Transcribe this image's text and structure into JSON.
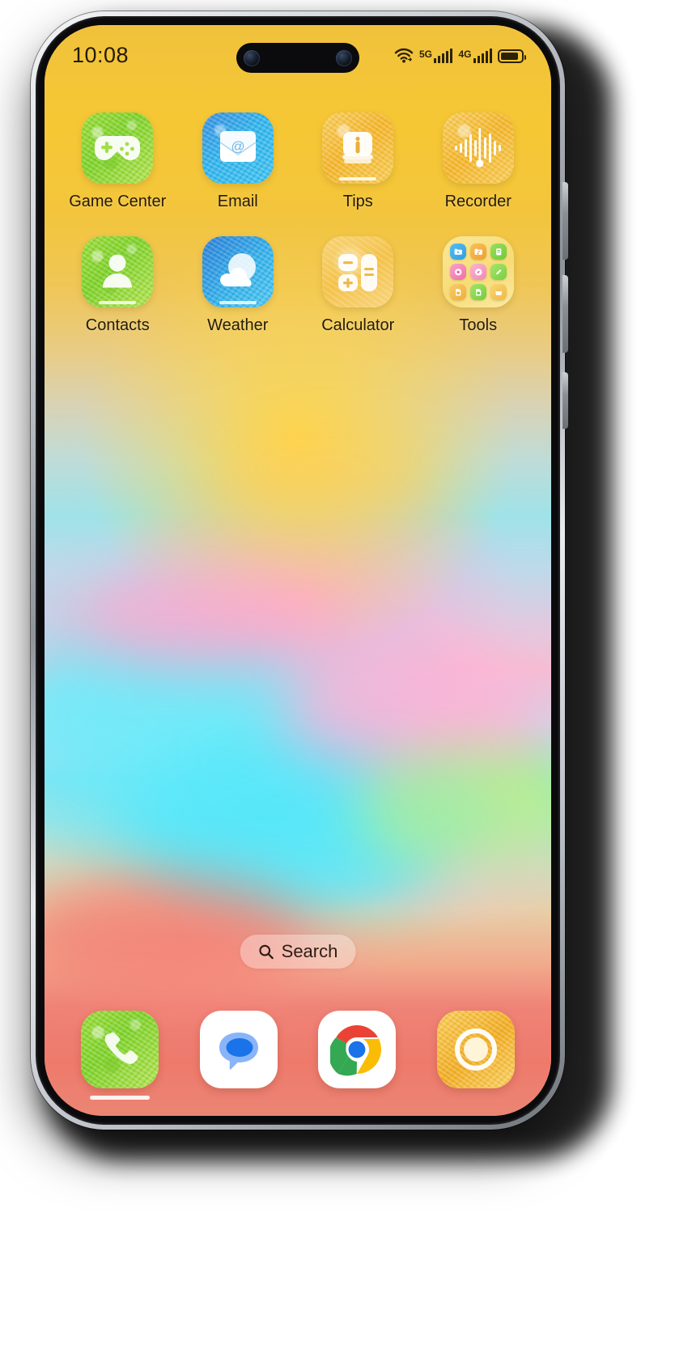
{
  "status_bar": {
    "time": "10:08",
    "icons": [
      {
        "name": "wifi-icon",
        "label": ""
      },
      {
        "name": "signal-5g-icon",
        "label": "5G"
      },
      {
        "name": "signal-4g-icon",
        "label": "4G"
      },
      {
        "name": "battery-icon",
        "label": ""
      }
    ]
  },
  "home_screen": {
    "rows": [
      [
        {
          "label": "Game Center",
          "icon": "gamepad-icon",
          "style": "tex-green",
          "dot": false
        },
        {
          "label": "Email",
          "icon": "envelope-at-icon",
          "style": "tex-blue",
          "dot": false
        },
        {
          "label": "Tips",
          "icon": "info-card-icon",
          "style": "tex-amber",
          "dot": true
        },
        {
          "label": "Recorder",
          "icon": "waveform-icon",
          "style": "tex-amber",
          "dot": false
        }
      ],
      [
        {
          "label": "Contacts",
          "icon": "person-icon",
          "style": "tex-green",
          "dot": true
        },
        {
          "label": "Weather",
          "icon": "sun-cloud-icon",
          "style": "tex-blue2",
          "dot": true
        },
        {
          "label": "Calculator",
          "icon": "calculator-icon",
          "style": "tex-amber-soft",
          "dot": false
        },
        {
          "label": "Tools",
          "icon": "folder-icon",
          "style": "tex-folder",
          "dot": false
        }
      ]
    ],
    "folder_apps": [
      {
        "name": "video-folder-icon",
        "color": "#3aa8e8"
      },
      {
        "name": "music-folder-icon",
        "color": "#f0a83a"
      },
      {
        "name": "notes-icon",
        "color": "#7ed348"
      },
      {
        "name": "record-icon",
        "color": "#f273a8"
      },
      {
        "name": "compass-icon",
        "color": "#f58fb8"
      },
      {
        "name": "memo-icon",
        "color": "#8ada5a"
      },
      {
        "name": "sim1-icon",
        "color": "#f3c04a"
      },
      {
        "name": "sim2-icon",
        "color": "#7fd24a"
      },
      {
        "name": "calendar-icon",
        "color": "#f2c85a"
      }
    ]
  },
  "search": {
    "placeholder": "Search",
    "icon": "search-icon"
  },
  "dock": {
    "apps": [
      {
        "name": "phone-app",
        "icon": "phone-icon",
        "label": "Phone"
      },
      {
        "name": "messages-app",
        "icon": "message-bubble-icon",
        "label": "Messages"
      },
      {
        "name": "chrome-app",
        "icon": "chrome-icon",
        "label": "Chrome"
      },
      {
        "name": "camera-app",
        "icon": "camera-ring-icon",
        "label": "Camera"
      }
    ]
  },
  "colors": {
    "accent_green": "#8ed432",
    "accent_blue": "#35b9ec",
    "accent_amber": "#f2b52c",
    "dock_bg": "#ee8170",
    "status_text": "#221a08"
  }
}
